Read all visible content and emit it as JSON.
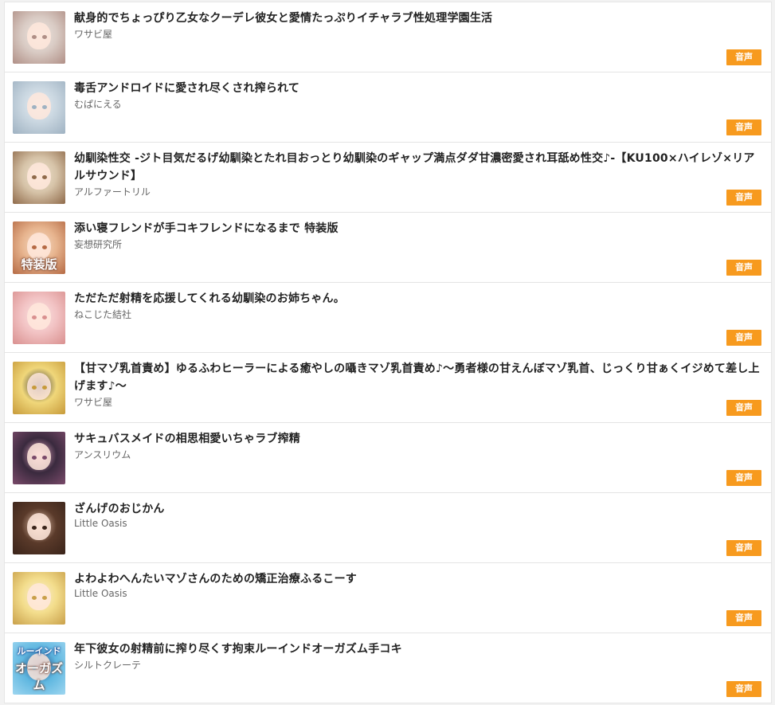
{
  "items": [
    {
      "title": "献身的でちょっぴり乙女なクーデレ彼女と愛情たっぷりイチャラブ性処理学園生活",
      "circle": "ワサビ屋",
      "badge": "音声",
      "thumb_icon": "silver-hair-girl-cover-thumbnail",
      "thumb_colors": [
        "#d9cbc4",
        "#efe7e2",
        "#b08f86"
      ]
    },
    {
      "title": "毒舌アンドロイドに愛され尽くされ搾られて",
      "circle": "むぱにえる",
      "badge": "音声",
      "thumb_icon": "android-girl-cover-thumbnail",
      "thumb_colors": [
        "#c9d6e0",
        "#e8eef3",
        "#9fb2c2"
      ]
    },
    {
      "title": "幼馴染性交 -ジト目気だるげ幼馴染とたれ目おっとり幼馴染のギャップ満点ダダ甘濃密愛され耳舐め性交♪-【KU100×ハイレゾ×リアルサウンド】",
      "circle": "アルファートリル",
      "badge": "音声",
      "thumb_icon": "two-childhood-friends-cover-thumbnail",
      "thumb_colors": [
        "#d6c3a8",
        "#f1e6d2",
        "#8f6a4a"
      ]
    },
    {
      "title": "添い寝フレンドが手コキフレンドになるまで 特装版",
      "circle": "妄想研究所",
      "badge": "音声",
      "thumb_icon": "special-edition-cover-thumbnail",
      "thumb_colors": [
        "#e7b48e",
        "#f6dcc6",
        "#b56a44"
      ],
      "thumb_caption": "特装版"
    },
    {
      "title": "ただただ射精を応援してくれる幼馴染のお姉ちゃん。",
      "circle": "ねこじた結社",
      "badge": "音声",
      "thumb_icon": "pink-hair-girl-cover-thumbnail",
      "thumb_colors": [
        "#f2c3c4",
        "#fbe6e4",
        "#d9908f"
      ]
    },
    {
      "title": "【甘マゾ乳首責め】ゆるふわヒーラーによる癒やしの囁きマゾ乳首責め♪～勇者様の甘えんぼマゾ乳首、じっくり甘ぁくイジめて差し上げます♪～",
      "circle": "ワサビ屋",
      "badge": "音声",
      "thumb_icon": "blonde-healer-cover-thumbnail",
      "thumb_colors": [
        "#f0d77a",
        "#2d2d3a",
        "#c79a3a"
      ]
    },
    {
      "title": "サキュバスメイドの相思相愛いちゃラブ搾精",
      "circle": "アンスリウム",
      "badge": "音声",
      "thumb_icon": "succubus-maid-cover-thumbnail",
      "thumb_colors": [
        "#3a2a3e",
        "#e8a9c4",
        "#7a4a6a"
      ]
    },
    {
      "title": "ざんげのおじかん",
      "circle": "Little Oasis",
      "badge": "音声",
      "thumb_icon": "brown-hair-girl-cover-thumbnail",
      "thumb_colors": [
        "#5a3a2a",
        "#e9c7b0",
        "#3a241a"
      ]
    },
    {
      "title": "よわよわへんたいマゾさんのための矯正治療ふるこーす",
      "circle": "Little Oasis",
      "badge": "音声",
      "thumb_icon": "blonde-twintail-girl-cover-thumbnail",
      "thumb_colors": [
        "#f3dd8c",
        "#fbefd6",
        "#c9a04a"
      ]
    },
    {
      "title": "年下彼女の射精前に搾り尽くす拘束ルーインドオーガズム手コキ",
      "circle": "シルトクレーテ",
      "badge": "音声",
      "thumb_icon": "ruined-orgasm-cover-thumbnail",
      "thumb_colors": [
        "#5fb7e0",
        "#1e3f7a",
        "#9ed6f0"
      ],
      "thumb_caption_top": "ルーインド",
      "thumb_caption": "オーガズム"
    }
  ]
}
